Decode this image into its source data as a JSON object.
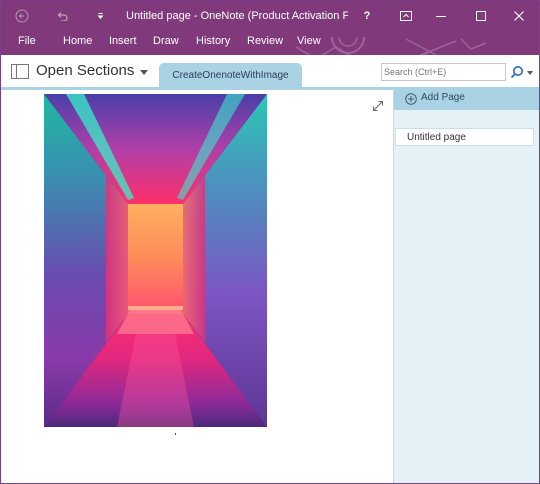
{
  "window": {
    "title": "Untitled page - OneNote (Product Activation F..."
  },
  "title_bar": {
    "back_icon": "back-arrow-icon",
    "undo_icon": "undo-icon",
    "quick_access_icon": "customize-quick-access-icon",
    "help_label": "?",
    "ribbon_display_icon": "ribbon-display-options-icon",
    "minimize_icon": "minimize-icon",
    "maximize_icon": "maximize-icon",
    "close_icon": "close-icon"
  },
  "menu": {
    "items": [
      {
        "label": "File"
      },
      {
        "label": "Home"
      },
      {
        "label": "Insert"
      },
      {
        "label": "Draw"
      },
      {
        "label": "History"
      },
      {
        "label": "Review"
      },
      {
        "label": "View"
      }
    ]
  },
  "section_bar": {
    "notebook_label": "Open Sections",
    "notebook_icon": "notebook-icon",
    "active_section": "CreateOnenoteWithImage"
  },
  "search": {
    "value": "",
    "placeholder": "Search (Ctrl+E)",
    "icon": "search-icon"
  },
  "page": {
    "expand_icon": "expand-icon",
    "image_subject": "neon-corridor-photo"
  },
  "pages_pane": {
    "add_page_label": "Add Page",
    "add_page_icon": "plus-circle-icon",
    "pages": [
      {
        "title": "Untitled page",
        "selected": true
      }
    ]
  },
  "colors": {
    "title_bar": "#80397b",
    "section_tab": "#a9d3e4",
    "page_pane": "#e4f2f8"
  }
}
